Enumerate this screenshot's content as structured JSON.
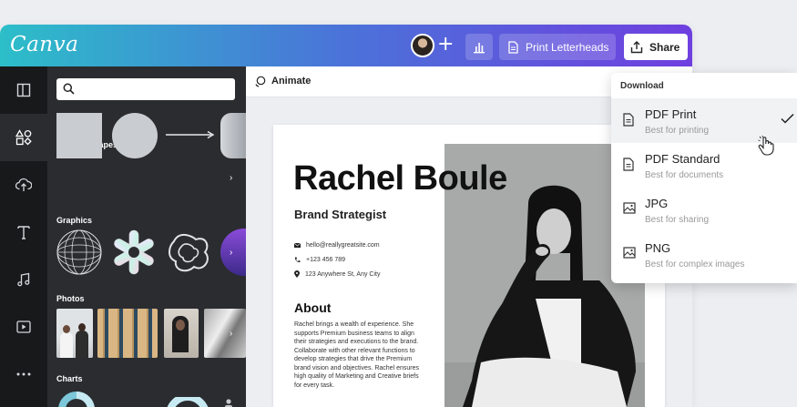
{
  "header": {
    "logo": "Canva",
    "print_label": "Print Letterheads",
    "share_label": "Share"
  },
  "sidebar": {
    "rail_icons": [
      "layout-icon",
      "elements-icon",
      "upload-icon",
      "text-icon",
      "music-icon",
      "video-icon",
      "more-icon"
    ]
  },
  "panel": {
    "search_placeholder": "",
    "sections": {
      "lines_shapes": "Lines & Shapes",
      "graphics": "Graphics",
      "photos": "Photos",
      "charts": "Charts"
    }
  },
  "canvas": {
    "animate_label": "Animate"
  },
  "document": {
    "name": "Rachel Boule",
    "role": "Brand Strategist",
    "email": "hello@reallygreatsite.com",
    "phone": "+123 456 789",
    "address": "123 Anywhere St, Any City",
    "about_title": "About",
    "about_body": "Rachel brings a wealth of experience. She supports Premium business teams to align their strategies and executions to the brand. Collaborate with other relevant functions to develop strategies that drive the Premium brand vision and objectives. Rachel ensures high quality of Marketing and Creative briefs for every task."
  },
  "download": {
    "title": "Download",
    "items": [
      {
        "label": "PDF Print",
        "sub": "Best for printing",
        "selected": true
      },
      {
        "label": "PDF Standard",
        "sub": "Best for documents",
        "selected": false
      },
      {
        "label": "JPG",
        "sub": "Best for sharing",
        "selected": false
      },
      {
        "label": "PNG",
        "sub": "Best for complex images",
        "selected": false
      }
    ]
  },
  "colors": {
    "gradient_start": "#2cbec9",
    "gradient_mid": "#4b72d9",
    "gradient_end": "#6f3fdf",
    "rail": "#18191b",
    "panel": "#2b2c30"
  }
}
